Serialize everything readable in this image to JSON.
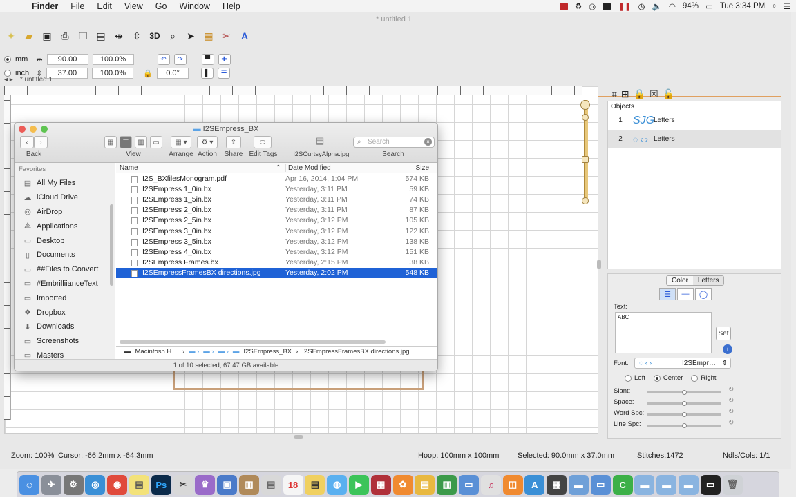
{
  "menubar": {
    "app": "Finder",
    "items": [
      "File",
      "Edit",
      "View",
      "Go",
      "Window",
      "Help"
    ],
    "battery": "94%",
    "clock": "Tue 3:34 PM"
  },
  "app": {
    "title": "* untitled 1",
    "tab_label": "* untitled 1",
    "units": {
      "mm": "mm",
      "inch": "inch"
    },
    "width": "90.00",
    "width_pct": "100.0%",
    "height": "37.00",
    "height_pct": "100.0%",
    "rotation": "0.0°"
  },
  "objects": {
    "header": "Objects",
    "rows": [
      {
        "num": "1",
        "name": "Letters"
      },
      {
        "num": "2",
        "name": "Letters"
      }
    ]
  },
  "props": {
    "tabs": [
      "Color",
      "Letters"
    ],
    "text_label": "Text:",
    "text_value": "ABC",
    "set_label": "Set",
    "font_label": "Font:",
    "font_value": "I2SEmpr…",
    "align": [
      "Left",
      "Center",
      "Right"
    ],
    "sliders": [
      "Slant:",
      "Space:",
      "Word Spc:",
      "Line Spc:"
    ]
  },
  "status": {
    "zoom": "Zoom: 100%",
    "cursor": "Cursor: -66.2mm x -64.3mm",
    "hoop": "Hoop: 100mm x 100mm",
    "selected": "Selected: 90.0mm x 37.0mm",
    "stitches": "Stitches:1472",
    "ndls": "Ndls/Cols: 1/1"
  },
  "finder": {
    "title": "I2SEmpress_BX",
    "toolbar": {
      "back": "Back",
      "view": "View",
      "arrange": "Arrange",
      "action": "Action",
      "share": "Share",
      "edit_tags": "Edit Tags",
      "file_label": "i2SCurtsyAlpha.jpg",
      "search_placeholder": "Search",
      "search": "Search"
    },
    "sidebar": {
      "header": "Favorites",
      "items": [
        "All My Files",
        "iCloud Drive",
        "AirDrop",
        "Applications",
        "Desktop",
        "Documents",
        "##Files to Convert",
        "#EmbrilliianceText",
        "Imported",
        "Dropbox",
        "Downloads",
        "Screenshots",
        "Masters"
      ]
    },
    "columns": [
      "Name",
      "Date Modified",
      "Size"
    ],
    "files": [
      {
        "name": "I2S_BXfilesMonogram.pdf",
        "date": "Apr 16, 2014, 1:04 PM",
        "size": "574 KB"
      },
      {
        "name": "I2SEmpress 1_0in.bx",
        "date": "Yesterday, 3:11 PM",
        "size": "59 KB"
      },
      {
        "name": "I2SEmpress 1_5in.bx",
        "date": "Yesterday, 3:11 PM",
        "size": "74 KB"
      },
      {
        "name": "I2SEmpress 2_0in.bx",
        "date": "Yesterday, 3:11 PM",
        "size": "87 KB"
      },
      {
        "name": "I2SEmpress 2_5in.bx",
        "date": "Yesterday, 3:12 PM",
        "size": "105 KB"
      },
      {
        "name": "I2SEmpress 3_0in.bx",
        "date": "Yesterday, 3:12 PM",
        "size": "122 KB"
      },
      {
        "name": "I2SEmpress 3_5in.bx",
        "date": "Yesterday, 3:12 PM",
        "size": "138 KB"
      },
      {
        "name": "I2SEmpress 4_0in.bx",
        "date": "Yesterday, 3:12 PM",
        "size": "151 KB"
      },
      {
        "name": "I2SEmpress Frames.bx",
        "date": "Yesterday, 2:15 PM",
        "size": "38 KB"
      },
      {
        "name": "I2SEmpressFramesBX directions.jpg",
        "date": "Yesterday, 2:02 PM",
        "size": "548 KB"
      }
    ],
    "selected_index": 9,
    "path": [
      "Macintosh H…",
      "I2SEmpress_BX",
      "I2SEmpressFramesBX directions.jpg"
    ],
    "status": "1 of 10 selected, 67.47 GB available"
  },
  "colors": {
    "selection": "#1f62d6",
    "accent_orange": "#e0a060",
    "hoop": "#c9a07a"
  }
}
